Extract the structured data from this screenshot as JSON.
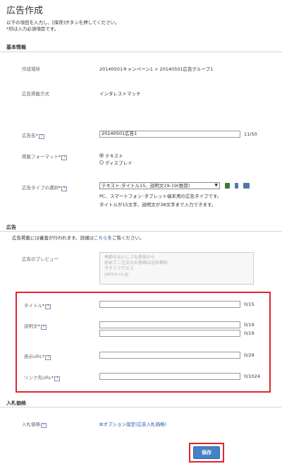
{
  "page": {
    "title": "広告作成",
    "intro_line1": "以下の項目を入力し、[保存]ボタンを押してください。",
    "intro_star": "*",
    "intro_line2": "印は入力必須項目です。"
  },
  "basic_info": {
    "heading": "基本情報",
    "location_label": "作成場所",
    "location_value": "20140501キャンペーン1 > 20140501広告グループ1",
    "method_label": "広告掲載方式",
    "method_value": "インタレストマッチ",
    "ad_name_label": "広告名",
    "ad_name_value": "20140501広告1",
    "ad_name_count": "11/50",
    "format_label": "掲載フォーマット",
    "format_options": [
      "テキスト",
      "ディスプレイ"
    ],
    "format_selected": "テキスト",
    "type_label": "広告タイプの選択",
    "type_selected": "テキスト:タイトル15、説明文19-19(推奨)",
    "type_note1": "PC、スマートフォン･タブレット端末用の広告タイプです。",
    "type_note2": "タイトルが15文字、説明文が38文字まで入力できます。"
  },
  "ad": {
    "heading": "広告",
    "review_prefix": "広告掲載には審査が行われます。詳細は",
    "review_link": "こちら",
    "review_suffix": "をご覧ください。",
    "preview_label": "広告のプレビュー",
    "preview_lines": [
      "季節のおいしさを産地から",
      "初めてご注文のお客様は送料無料",
      "今すぐアクセス",
      "yahoo.co.jp"
    ],
    "title_label": "タイトル",
    "title_count": "0/15",
    "desc_label": "説明文",
    "desc_count1": "0/19",
    "desc_count2": "0/19",
    "display_url_label": "表示URL",
    "display_url_count": "0/29",
    "link_url_label": "リンク先URL",
    "link_url_count": "0/1024"
  },
  "bid": {
    "heading": "入札価格",
    "price_label": "入札価格",
    "option_link": "オプション設定(広告入札価格)"
  },
  "actions": {
    "save_label": "保存"
  },
  "icons": {
    "help": "?",
    "plus": "⊞"
  },
  "colors": {
    "highlight_red": "#e02433",
    "save_blue": "#4682c8",
    "link_blue": "#2255bb",
    "required_red": "#cc0000"
  }
}
